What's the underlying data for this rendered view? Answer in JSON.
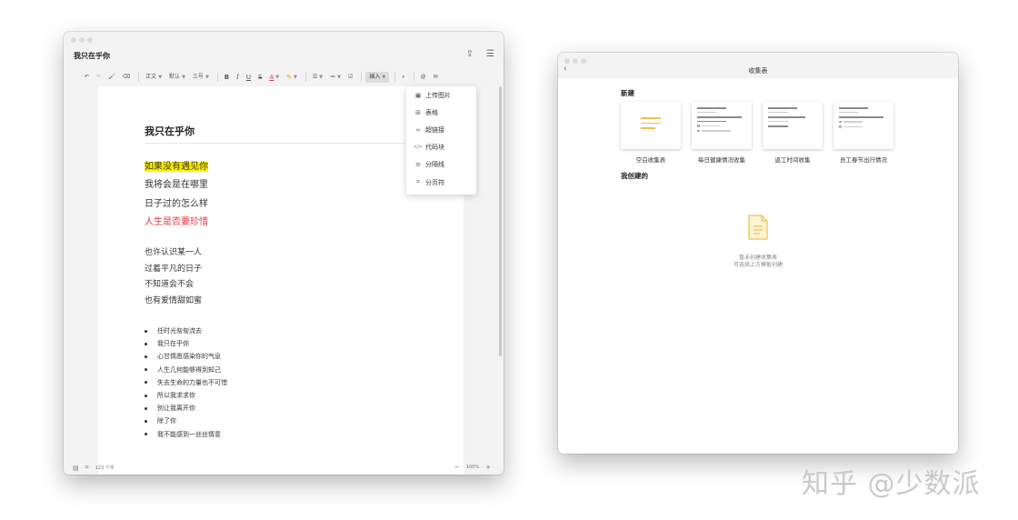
{
  "editor": {
    "title": "我只在乎你",
    "toolbar": {
      "undo": "↶",
      "redo": "↷",
      "format_painter": "🖌",
      "eraser": "⌫",
      "style_select": "正文",
      "font_select": "默认",
      "size_select": "三号",
      "bold": "B",
      "italic": "I",
      "underline": "U",
      "strike": "S",
      "font_color": "A",
      "highlight": "✎",
      "align": "☰",
      "list": "≔",
      "checkbox": "☑",
      "insert": "插入",
      "find": "⌕",
      "mention": "@",
      "comment": "✉"
    },
    "heading": "我只在乎你",
    "stanza1": [
      "如果没有遇见你",
      "我将会是在哪里",
      "日子过的怎么样",
      "人生是否要珍惜"
    ],
    "stanza2": [
      "也许认识某一人",
      "过着平凡的日子",
      "不知道会不会",
      "也有爱情甜如蜜"
    ],
    "bullets": [
      "任时光匆匆流去",
      "我只在乎你",
      "心甘情愿感染你的气息",
      "人生几何能够得到知己",
      "失去生命的力量也不可惜",
      "所以我求求你",
      "别让我离开你",
      "除了你",
      "我不能感到一丝丝情意"
    ],
    "insert_menu": [
      {
        "icon": "image-icon",
        "glyph": "▣",
        "label": "上传图片"
      },
      {
        "icon": "table-icon",
        "glyph": "⊞",
        "label": "表格"
      },
      {
        "icon": "link-icon",
        "glyph": "∞",
        "label": "超链接"
      },
      {
        "icon": "code-icon",
        "glyph": "</>",
        "label": "代码块"
      },
      {
        "icon": "divider-icon",
        "glyph": "≡",
        "label": "分隔线"
      },
      {
        "icon": "page-break-icon",
        "glyph": "⌗",
        "label": "分页符"
      }
    ],
    "status": {
      "word_count": "123 个字",
      "zoom": "100%",
      "minus": "−",
      "plus": "+"
    },
    "colors": {
      "highlight": "#fff200",
      "red_text": "#e0333a"
    }
  },
  "collection": {
    "title": "收集表",
    "back": "‹",
    "new_section": "新建",
    "templates": [
      {
        "label": "空白收集表"
      },
      {
        "label": "每日健康情况收集"
      },
      {
        "label": "返工时间收集"
      },
      {
        "label": "员工春节出行情况"
      }
    ],
    "mine_section": "我创建的",
    "empty_line1": "暂未创建收集表",
    "empty_line2": "可选择上方模板创建"
  },
  "watermark": "知乎 @少数派"
}
